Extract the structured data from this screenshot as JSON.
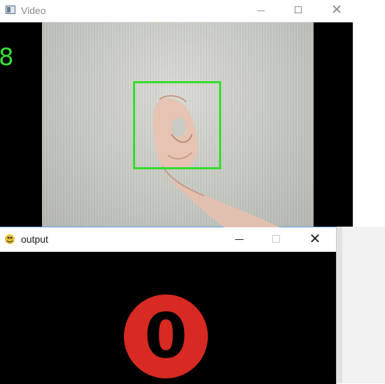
{
  "video_window": {
    "title": "Video",
    "frame_count": "8",
    "icons": {
      "app": "video-window-icon",
      "minimize": "minimize-icon",
      "maximize": "maximize-icon",
      "close": "close-icon"
    },
    "colors": {
      "overlay_text": "#37e03a",
      "roi_box": "#33dd2c"
    }
  },
  "output_window": {
    "title": "output",
    "prediction": "0",
    "close_glyph": "✕",
    "icons": {
      "app": "pygame-snake-icon",
      "minimize": "minimize-icon",
      "maximize": "maximize-icon",
      "close": "close-icon"
    },
    "colors": {
      "badge": "#d62a22",
      "background": "#000000"
    }
  },
  "video_close_glyph": "✕"
}
